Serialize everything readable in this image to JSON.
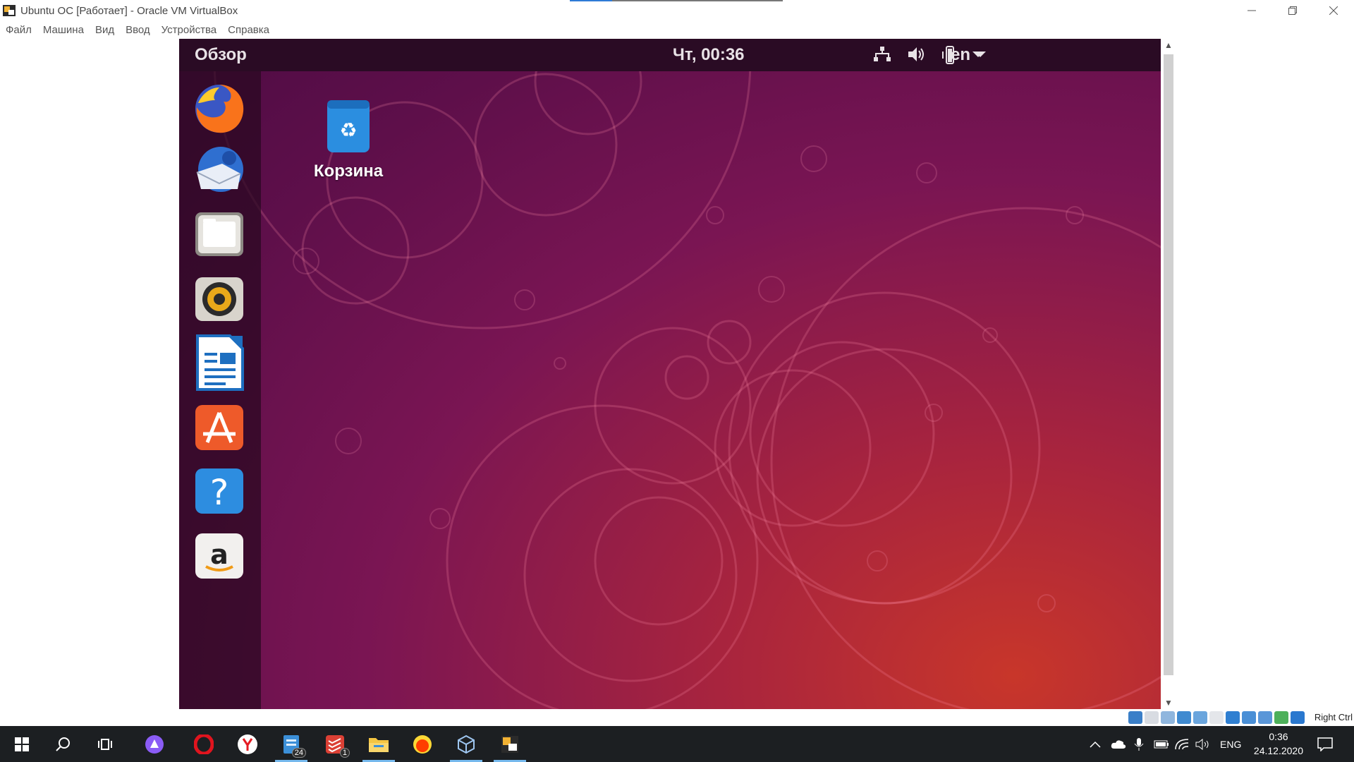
{
  "window": {
    "title": "Ubuntu OC [Работает] - Oracle VM VirtualBox",
    "menu": [
      "Файл",
      "Машина",
      "Вид",
      "Ввод",
      "Устройства",
      "Справка"
    ]
  },
  "guest": {
    "topbar": {
      "overview": "Обзор",
      "clock": "Чт, 00:36",
      "lang": "en"
    },
    "dock_apps": [
      "firefox",
      "thunderbird",
      "files",
      "rhythmbox",
      "libreoffice-writer",
      "ubuntu-software",
      "help",
      "amazon"
    ],
    "desktop_icon": {
      "label": "Корзина"
    }
  },
  "vbox_status": {
    "host_key": "Right Ctrl"
  },
  "taskbar": {
    "apps": [
      "start",
      "search",
      "task-view",
      "alice",
      "opera",
      "yandex-browser",
      "notepad-app",
      "todoist",
      "file-explorer",
      "yandex-music",
      "virtualbox",
      "virtualbox-vm"
    ],
    "badges": {
      "notepad-app": "24",
      "todoist": "1"
    },
    "tray_lang": "ENG",
    "time": "0:36",
    "date": "24.12.2020"
  },
  "colors": {
    "ubuntu_topbar": "#2a0b24",
    "taskbar": "#1c1f22",
    "accent_blue": "#76b9ed"
  }
}
